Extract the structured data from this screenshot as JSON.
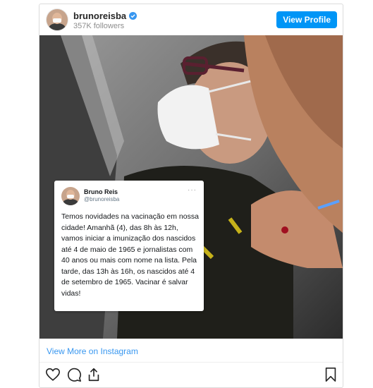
{
  "header": {
    "username": "brunoreisba",
    "followers": "357K followers",
    "view_profile_label": "View Profile",
    "verified_color": "#3897f0",
    "button_color": "#0095f6"
  },
  "tweet": {
    "name": "Bruno Reis",
    "handle": "@brunoreisba",
    "more": "···",
    "text": "Temos novidades na vacinação em nossa cidade! Amanhã (4), das 8h às 12h, vamos iniciar a imunização dos nascidos até 4 de maio de 1965 e jornalistas com 40 anos ou mais com nome na lista. Pela tarde, das 13h às 16h, os nascidos até 4 de setembro de 1965. Vacinar é salvar vidas!"
  },
  "footer": {
    "view_more_label": "View More on Instagram",
    "link_color": "#3897f0",
    "icons": [
      "heart-icon",
      "comment-icon",
      "share-icon",
      "bookmark-icon"
    ]
  }
}
